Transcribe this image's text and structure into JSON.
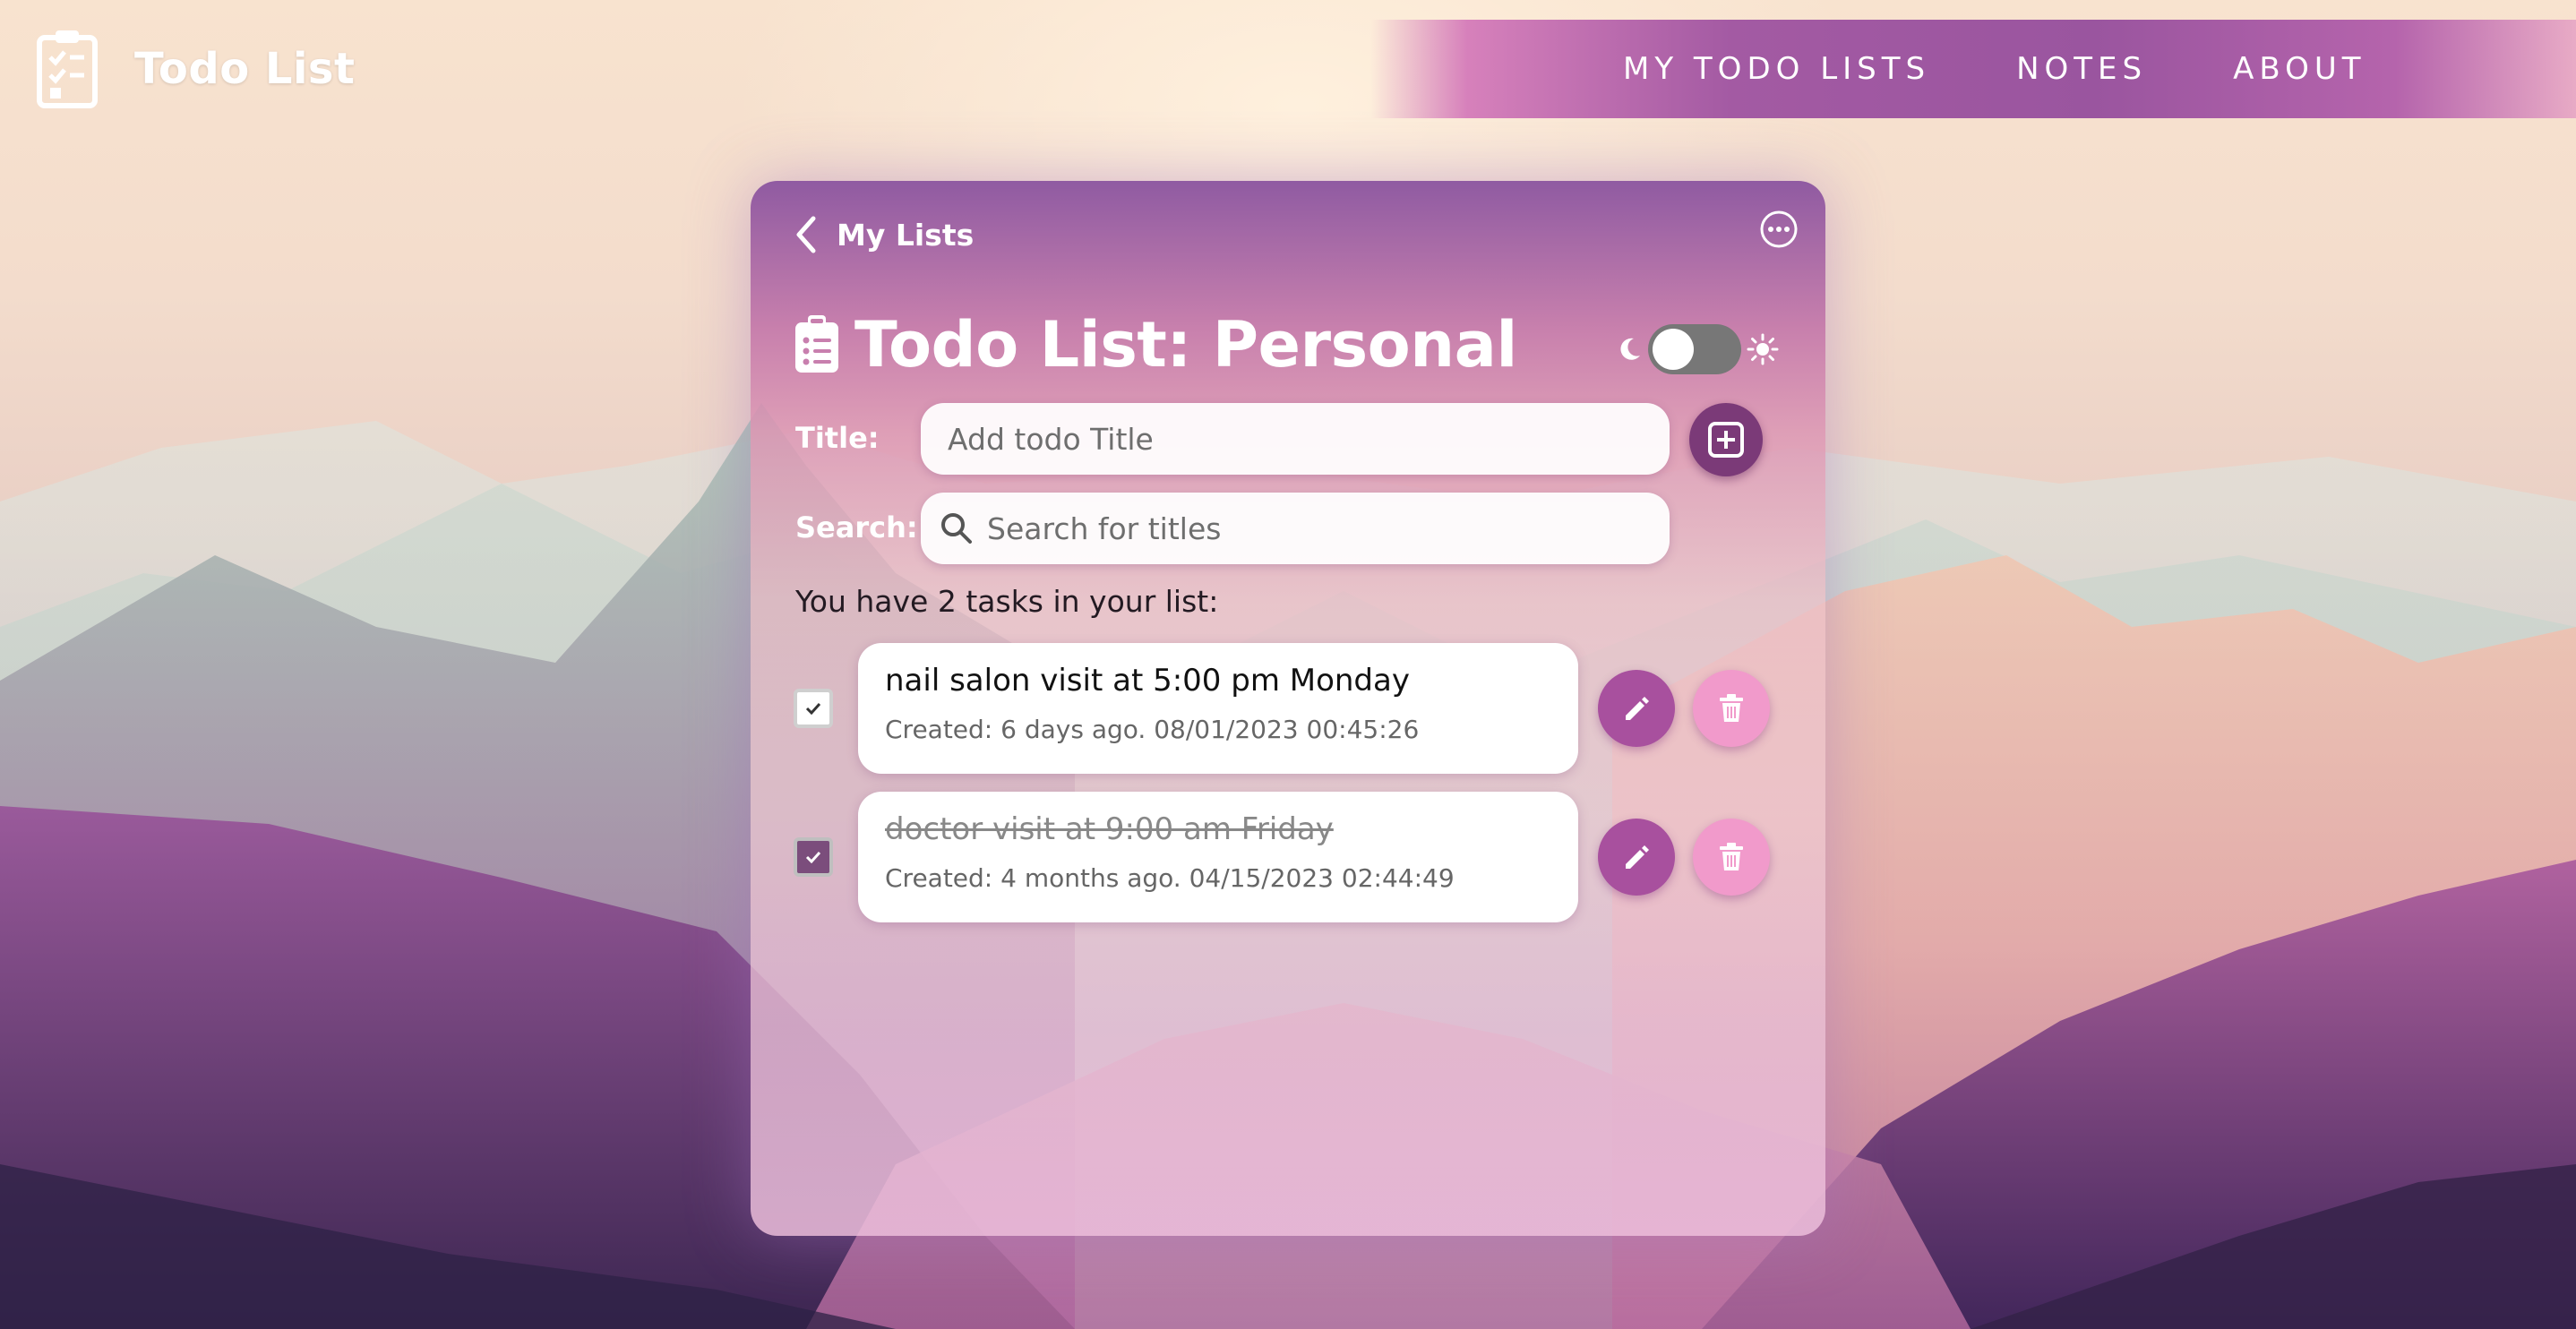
{
  "app": {
    "title": "Todo List"
  },
  "nav": {
    "items": [
      {
        "label": "MY TODO LISTS"
      },
      {
        "label": "NOTES"
      },
      {
        "label": "ABOUT"
      }
    ]
  },
  "card": {
    "back_label": "My Lists",
    "heading": "Todo List: Personal",
    "theme_toggle": {
      "state": "off",
      "left_icon": "moon-icon",
      "right_icon": "sun-icon"
    },
    "title_label": "Title:",
    "title_placeholder": "Add todo Title",
    "search_label": "Search:",
    "search_placeholder": "Search for titles",
    "count_text": {
      "prefix": "You have ",
      "count": "2",
      "suffix": " tasks in your list:"
    },
    "todos": [
      {
        "title": "nail salon visit at 5:00 pm Monday",
        "created": "Created: 6 days ago. 08/01/2023 00:45:26",
        "done": false
      },
      {
        "title": "doctor visit at 9:00 am Friday",
        "created": "Created: 4 months ago. 04/15/2023 02:44:49",
        "done": true
      }
    ]
  },
  "colors": {
    "accent": "#a8509e",
    "accent_dark": "#7b3a78",
    "delete": "#f19acb",
    "toggle_off": "#777777"
  }
}
